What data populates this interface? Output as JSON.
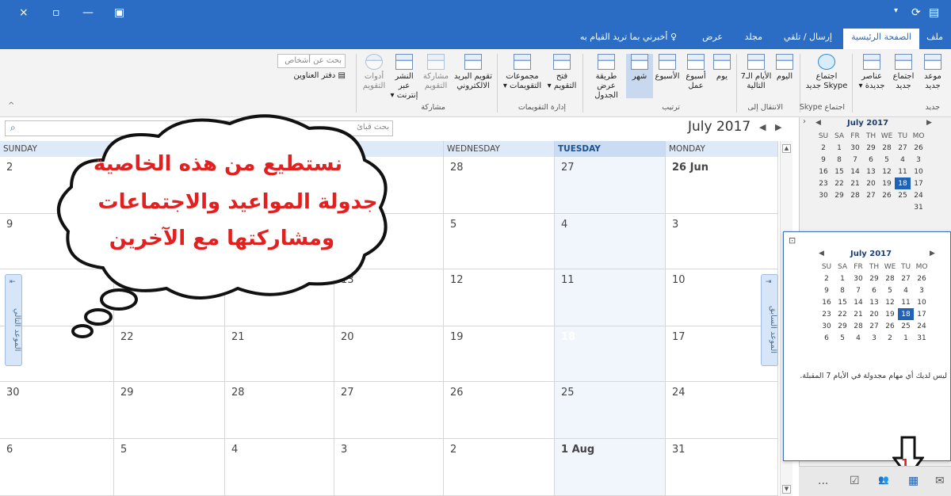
{
  "title_bar": {
    "close": "×",
    "restore": "▫",
    "minimize": "—",
    "layout": "▣"
  },
  "ribbon_tabs": [
    {
      "label": "ملف"
    },
    {
      "label": "الصفحة الرئيسية"
    },
    {
      "label": "إرسال / تلقي"
    },
    {
      "label": "مجلد"
    },
    {
      "label": "عرض"
    },
    {
      "label": "أخبرني بما تريد القيام به"
    }
  ],
  "ribbon": {
    "buttons": [
      {
        "label": "موعد\nجديد"
      },
      {
        "label": "اجتماع\nجديد"
      },
      {
        "label": "عناصر\nجديدة ▾"
      },
      {
        "label": "اجتماع\nSkype جديد"
      },
      {
        "label": "اليوم"
      },
      {
        "label": "الأيام الـ7\nالتالية"
      },
      {
        "label": "يوم"
      },
      {
        "label": "أسبوع\nعمل"
      },
      {
        "label": "الأسبوع"
      },
      {
        "label": "شهر"
      },
      {
        "label": "طريقة عرض\nالجدول"
      },
      {
        "label": "فتح\nالتقويم ▾"
      },
      {
        "label": "مجموعات\nالتقويمات ▾"
      },
      {
        "label": "تقويم البريد\nالالكتروني"
      },
      {
        "label": "مشاركة\nالتقويم"
      },
      {
        "label": "النشر عبر\nإنترنت ▾"
      },
      {
        "label": "أدوات\nالتقويم"
      }
    ],
    "groups": [
      {
        "label": "جديد"
      },
      {
        "label": "اجتماع Skype"
      },
      {
        "label": "الانتقال إلى"
      },
      {
        "label": "ترتيب"
      },
      {
        "label": "إدارة التقويمات"
      },
      {
        "label": "مشاركة"
      }
    ],
    "search_people_placeholder": "بحث عن أشخاص",
    "address_book": "دفتر العناوين"
  },
  "calendar": {
    "month_title": "July 2017",
    "search_placeholder": "بحث قبائ",
    "day_headers": [
      "SUNDAY",
      "",
      "",
      "WEDNESDAY",
      "TUESDAY",
      "MONDAY"
    ],
    "weeks": [
      [
        "2",
        "",
        "",
        "28",
        "27",
        "26 Jun"
      ],
      [
        "9",
        "",
        "",
        "5",
        "4",
        "3"
      ],
      [
        "",
        "",
        "13",
        "12",
        "11",
        "10"
      ],
      [
        "",
        "22",
        "21",
        "20",
        "19",
        "18",
        "17"
      ],
      [
        "30",
        "29",
        "28",
        "27",
        "26",
        "25",
        "24"
      ],
      [
        "6",
        "5",
        "4",
        "3",
        "2",
        "1 Aug",
        "31"
      ]
    ],
    "next_appt": "الموعد التالي",
    "prev_appt": "الموعد السابق"
  },
  "bubble": {
    "line1": "نستطيع من هذه الخاصية",
    "line2": "جدولة المواعيد والاجتماعات",
    "line3": "ومشاركتها مع الآخرين"
  },
  "mini_calendar": {
    "title": "July 2017",
    "day_names": [
      "SU",
      "SA",
      "FR",
      "TH",
      "WE",
      "TU",
      "MO"
    ],
    "rows": [
      [
        "2",
        "1",
        "30",
        "29",
        "28",
        "27",
        "26"
      ],
      [
        "9",
        "8",
        "7",
        "6",
        "5",
        "4",
        "3"
      ],
      [
        "16",
        "15",
        "14",
        "13",
        "12",
        "11",
        "10"
      ],
      [
        "23",
        "22",
        "21",
        "20",
        "19",
        "18",
        "17"
      ],
      [
        "30",
        "29",
        "28",
        "27",
        "26",
        "25",
        "24"
      ],
      [
        "",
        "",
        "",
        "",
        "",
        "",
        "31"
      ]
    ]
  },
  "popup_calendar": {
    "title": "July 2017",
    "rows": [
      [
        "2",
        "1",
        "30",
        "29",
        "28",
        "27",
        "26"
      ],
      [
        "9",
        "8",
        "7",
        "6",
        "5",
        "4",
        "3"
      ],
      [
        "16",
        "15",
        "14",
        "13",
        "12",
        "11",
        "10"
      ],
      [
        "23",
        "22",
        "21",
        "20",
        "19",
        "18",
        "17"
      ],
      [
        "30",
        "29",
        "28",
        "27",
        "26",
        "25",
        "24"
      ],
      [
        "6",
        "5",
        "4",
        "3",
        "2",
        "1",
        "31"
      ]
    ],
    "tasks_note": "ليس لديك أي مهام مجدولة في الأيام 7 المقبلة."
  },
  "callout_number": "1",
  "navbar": {
    "more": "...",
    "tasks": "☑",
    "people": "👥",
    "calendar": "▦",
    "mail": "✉"
  }
}
